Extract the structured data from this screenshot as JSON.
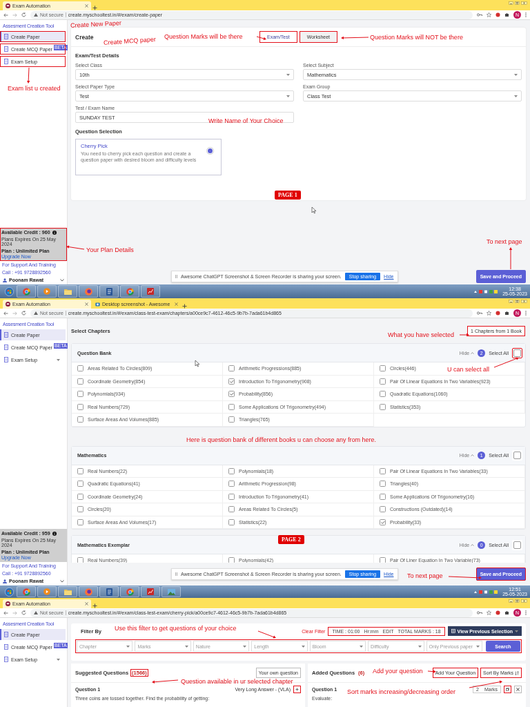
{
  "panels": [
    {
      "kind": "create",
      "browser": {
        "tabs": [
          {
            "title": "Exam Automation",
            "selected": true,
            "kind": "app"
          }
        ],
        "security": "Not secure",
        "url": "create.myschooltest.in/#/exam/create-paper",
        "profile_initial": "N"
      },
      "sidebar": {
        "title": "Assesment Creation Tool",
        "items": [
          {
            "label": "Create Paper",
            "selected": true,
            "annotated": true
          },
          {
            "label": "Create MCQ Paper",
            "selected": false,
            "badge": "BETA",
            "annotated": true
          },
          {
            "label": "Exam Setup",
            "selected": false,
            "annotated": true
          }
        ],
        "plan": {
          "credit": "Available Credit : 960",
          "expires": "Plans Expires On 25 May 2024",
          "plan": "Plan : Unlimited Plan",
          "upgrade": "Upgrade Now",
          "annotated": true
        },
        "support": "For Support And Training",
        "call": "Call : +91 9728892560",
        "user": "Poonam Rawat"
      },
      "main": {
        "heading": "Create",
        "modes": [
          {
            "label": "Exam/Test",
            "selected": true,
            "annotated": true
          },
          {
            "label": "Worksheet",
            "selected": false,
            "annotated": true
          }
        ],
        "section": "Exam/Test Details",
        "fields": [
          {
            "label": "Select Class",
            "value": "10th",
            "kind": "select"
          },
          {
            "label": "Select Subject",
            "value": "Mathematics",
            "kind": "select"
          },
          {
            "label": "Select Paper Type",
            "value": "Test",
            "kind": "select"
          },
          {
            "label": "Exam Group",
            "value": "Class Test",
            "kind": "select"
          },
          {
            "label": "Test / Exam Name",
            "value": "SUNDAY TEST",
            "kind": "text"
          }
        ],
        "selection_heading": "Question Selection",
        "options": [
          {
            "title": "Cherry Pick",
            "description": "You need to cherry pick each question and create a question paper with desired bloom and difficulty levels",
            "selected": true
          }
        ]
      },
      "footer": {
        "share_message": "Awesome ChatGPT Screenshot & Screen Recorder is sharing your screen.",
        "stop": "Stop sharing",
        "hide": "Hide",
        "proceed": "Save and Proceed",
        "proceed_annotated": false
      },
      "page_label": "PAGE 1",
      "annotations": [
        {
          "text": "Create New Paper"
        },
        {
          "text": "Create MCQ paper"
        },
        {
          "text": "Exam list u created"
        },
        {
          "text": "Question Marks will be there"
        },
        {
          "text": "Question Marks will NOT be there"
        },
        {
          "text": "Write Name of Your Choice"
        },
        {
          "text": "Your Plan Details"
        },
        {
          "text": "To next page"
        }
      ],
      "taskbar": {
        "apps": [
          {
            "kind": "start"
          },
          {
            "kind": "chrome"
          },
          {
            "kind": "media"
          },
          {
            "kind": "folder"
          },
          {
            "kind": "firefox"
          },
          {
            "kind": "docs"
          },
          {
            "kind": "chrome"
          },
          {
            "kind": "slides"
          }
        ],
        "time": "12:38",
        "date": "25-05-2023"
      }
    },
    {
      "kind": "chapters",
      "browser": {
        "tabs": [
          {
            "title": "Exam Automation",
            "selected": true,
            "kind": "app"
          },
          {
            "title": "Desktop screenshot - Awesome",
            "selected": false,
            "kind": "screenshot"
          }
        ],
        "security": "Not secure",
        "url": "create.myschooltest.in/#/exam/class-test-exam/chapters/a00ce9c7-4612-46c5-9b7b-7ada61b4d865",
        "profile_initial": "N"
      },
      "sidebar": {
        "title": "Assesment Creation Tool",
        "items": [
          {
            "label": "Create Paper",
            "selected": true,
            "annotated": false
          },
          {
            "label": "Create MCQ Paper",
            "selected": false,
            "badge": "BETA",
            "annotated": false
          },
          {
            "label": "Exam Setup",
            "selected": false,
            "expandable": true,
            "annotated": false
          }
        ],
        "plan": {
          "credit": "Available Credit : 959",
          "expires": "Plans Expires On 25 May 2024",
          "plan": "Plan : Unlimited Plan",
          "upgrade": "Upgrade Now",
          "annotated": false
        },
        "support": "For Support And Training",
        "call": "Call : +91 9728892560",
        "user": "Poonam Rawat"
      },
      "main": {
        "heading": "Select Chapters",
        "summary": "1 Chapters from 1 Book",
        "summary_annotated": true,
        "books": [
          {
            "title": "Question Bank",
            "hide": "Hide",
            "count": "2",
            "select_all_label": "Select All",
            "select_all": false,
            "select_all_annotated": true,
            "chapters": [
              {
                "name": "Areas Related To Circles(809)",
                "checked": false
              },
              {
                "name": "Arithmetic Progressions(885)",
                "checked": false
              },
              {
                "name": "Circles(446)",
                "checked": false
              },
              {
                "name": "Coordinate Geometry(854)",
                "checked": false
              },
              {
                "name": "Introduction To Trigonometry(908)",
                "checked": true
              },
              {
                "name": "Pair Of Linear Equations In Two Variables(923)",
                "checked": false
              },
              {
                "name": "Polynomials(934)",
                "checked": false
              },
              {
                "name": "Probability(856)",
                "checked": true
              },
              {
                "name": "Quadratic Equations(1060)",
                "checked": false
              },
              {
                "name": "Real Numbers(729)",
                "checked": false
              },
              {
                "name": "Some Applications Of Trigonometry(494)",
                "checked": false
              },
              {
                "name": "Statistics(353)",
                "checked": false
              },
              {
                "name": "Surface Areas And Volumes(885)",
                "checked": false
              },
              {
                "name": "Triangles(765)",
                "checked": false
              }
            ]
          },
          {
            "title": "Mathematics",
            "hide": "Hide",
            "count": "1",
            "select_all_label": "Select All",
            "select_all": false,
            "select_all_annotated": false,
            "chapters": [
              {
                "name": "Real Numbers(22)",
                "checked": false
              },
              {
                "name": "Polynomials(18)",
                "checked": false
              },
              {
                "name": "Pair Of Linear Equations In Two Variables(33)",
                "checked": false
              },
              {
                "name": "Quadratic Equations(41)",
                "checked": false
              },
              {
                "name": "Arithmetic Progression(98)",
                "checked": false
              },
              {
                "name": "Triangles(40)",
                "checked": false
              },
              {
                "name": "Coordinate Geometry(24)",
                "checked": false
              },
              {
                "name": "Introduction To Trigonometry(41)",
                "checked": false
              },
              {
                "name": "Some Applications Of Trigonometry(16)",
                "checked": false
              },
              {
                "name": "Circles(20)",
                "checked": false
              },
              {
                "name": "Areas Related To Circles(5)",
                "checked": false
              },
              {
                "name": "Constructions (Outdated)(14)",
                "checked": false
              },
              {
                "name": "Surface Areas And Volumes(17)",
                "checked": false
              },
              {
                "name": "Statistics(22)",
                "checked": false
              },
              {
                "name": "Probability(33)",
                "checked": true
              }
            ]
          },
          {
            "title": "Mathematics Exemplar",
            "hide": "Hide",
            "count": "0",
            "select_all_label": "Select All",
            "select_all": false,
            "select_all_annotated": false,
            "chapters": [
              {
                "name": "Real Numbers(39)",
                "checked": false
              },
              {
                "name": "Polynomials(42)",
                "checked": false
              },
              {
                "name": "Pair Of Liner Equation In Two Variable(73)",
                "checked": false
              }
            ]
          }
        ]
      },
      "footer": {
        "share_message": "Awesome ChatGPT Screenshot & Screen Recorder is sharing your screen.",
        "stop": "Stop sharing",
        "hide": "Hide",
        "proceed": "Save and Proceed",
        "proceed_annotated": true
      },
      "page_label": "PAGE 2",
      "annotations": [
        {
          "text": "What you have selected"
        },
        {
          "text": "U can select all"
        },
        {
          "text": "Here is question bank of different books u can choose any from here."
        },
        {
          "text": "To next page"
        }
      ],
      "taskbar": {
        "apps": [
          {
            "kind": "start"
          },
          {
            "kind": "chrome"
          },
          {
            "kind": "media"
          },
          {
            "kind": "folder"
          },
          {
            "kind": "firefox"
          },
          {
            "kind": "docs"
          },
          {
            "kind": "chrome"
          },
          {
            "kind": "slides"
          },
          {
            "kind": "photos"
          }
        ],
        "time": "12:51",
        "date": "25-05-2023"
      }
    },
    {
      "kind": "pick",
      "browser": {
        "tabs": [
          {
            "title": "Exam Automation",
            "selected": true,
            "kind": "app"
          }
        ],
        "security": "Not secure",
        "url": "create.myschooltest.in/#/exam/class-test-exam/cherry-pick/a00ce9c7-4612-46c5-9b7b-7ada61b4d865",
        "profile_initial": "N"
      },
      "sidebar": {
        "title": "Assesment Creation Tool",
        "items": [
          {
            "label": "Create Paper",
            "selected": true,
            "annotated": false
          },
          {
            "label": "Create MCQ Paper",
            "selected": false,
            "badge": "BETA",
            "annotated": false
          },
          {
            "label": "Exam Setup",
            "selected": false,
            "expandable": true,
            "annotated": false
          }
        ]
      },
      "main": {
        "filter": {
          "title": "Filter By",
          "clear": "Clear Filter",
          "time": "TIME : 01:00",
          "time_unit": "Hr:mm",
          "edit": "EDIT",
          "total": "TOTAL MARKS : 18",
          "summary_annotated": true,
          "view_previous": "View Previous Selection",
          "dropdowns": [
            {
              "placeholder": "Chapter"
            },
            {
              "placeholder": "Marks"
            },
            {
              "placeholder": "Nature"
            },
            {
              "placeholder": "Length"
            },
            {
              "placeholder": "Bloom"
            },
            {
              "placeholder": "Difficulty"
            },
            {
              "placeholder": "Only Previous paper"
            }
          ],
          "dropdowns_annotated": true,
          "search": "Search"
        },
        "suggested": {
          "title": "Suggested Questions",
          "count": "(1566)",
          "count_annotated": true,
          "own": "Your own question",
          "question": {
            "title": "Question 1",
            "type": "Very Long Answer - (VLA)",
            "add_annotated": true,
            "text": "Three coins are tossed together. Find the probability of getting:"
          }
        },
        "added": {
          "title": "Added Questions",
          "count": "(6)",
          "buttons": [
            {
              "label": "Add Your Question",
              "kind": "add",
              "annotated": true
            },
            {
              "label": "Sort By Marks",
              "kind": "sort",
              "annotated": true
            }
          ],
          "question": {
            "title": "Question 1",
            "marks": "2",
            "marks_unit": "Marks",
            "copy_annotated": true,
            "text": "Evaluate:"
          }
        }
      },
      "annotations": [
        {
          "text": "Use this filter to get questions of your choice"
        },
        {
          "text": "Question available in ur selected chapter"
        },
        {
          "text": "Add your question"
        },
        {
          "text": "Sort marks increasing/decreasing order"
        }
      ]
    }
  ]
}
